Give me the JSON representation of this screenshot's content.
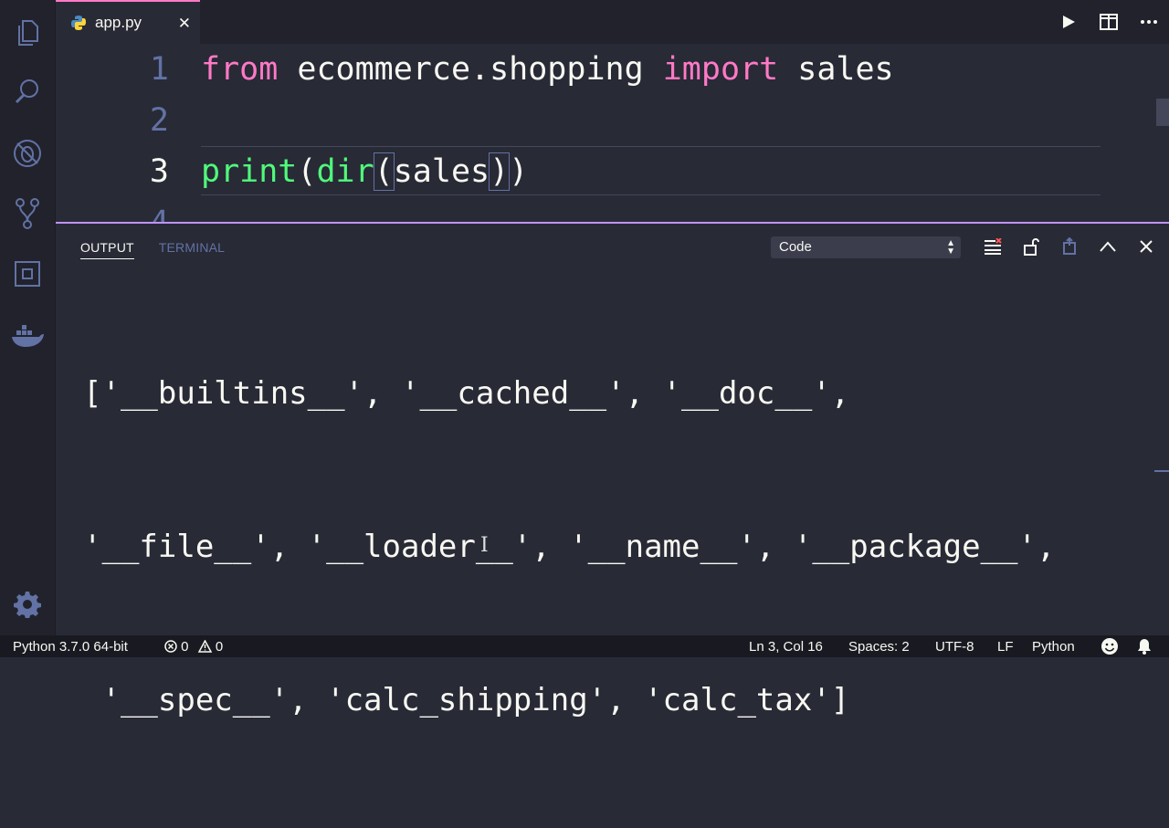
{
  "tab": {
    "filename": "app.py",
    "close_glyph": "✕"
  },
  "editor": {
    "lines": [
      {
        "number": "1",
        "tokens": [
          {
            "t": "from",
            "c": "kw"
          },
          {
            "t": " ecommerce.shopping ",
            "c": "plain"
          },
          {
            "t": "import",
            "c": "kw"
          },
          {
            "t": " sales",
            "c": "plain"
          }
        ]
      },
      {
        "number": "2",
        "tokens": []
      },
      {
        "number": "3",
        "tokens": [
          {
            "t": "print",
            "c": "fn"
          },
          {
            "t": "(",
            "c": "plain"
          },
          {
            "t": "dir",
            "c": "fn"
          },
          {
            "t": "(",
            "c": "plain",
            "box": true
          },
          {
            "t": "sales",
            "c": "plain"
          },
          {
            "t": ")",
            "c": "plain",
            "box": true
          },
          {
            "t": ")",
            "c": "plain"
          }
        ]
      },
      {
        "number": "4",
        "tokens": []
      }
    ],
    "active_line": 3
  },
  "panel": {
    "tabs": [
      {
        "label": "OUTPUT",
        "active": true
      },
      {
        "label": "TERMINAL",
        "active": false
      }
    ],
    "select_value": "Code",
    "output_lines": [
      "['__builtins__', '__cached__', '__doc__',",
      "'__file__', '__loader__', '__name__', '__package__',",
      " '__spec__', 'calc_shipping', 'calc_tax']"
    ]
  },
  "status": {
    "interpreter": "Python 3.7.0 64-bit",
    "errors": "0",
    "warnings": "0",
    "position": "Ln 3, Col 16",
    "spaces": "Spaces: 2",
    "encoding": "UTF-8",
    "eol": "LF",
    "language": "Python"
  },
  "colors": {
    "background": "#282a36",
    "keyword": "#ff79c6",
    "function": "#50fa7b",
    "accent": "#bd93f9"
  },
  "icons": {
    "activity": [
      "explorer-icon",
      "search-icon",
      "debug-icon",
      "source-control-icon",
      "extensions-icon",
      "docker-icon",
      "settings-gear-icon"
    ]
  }
}
